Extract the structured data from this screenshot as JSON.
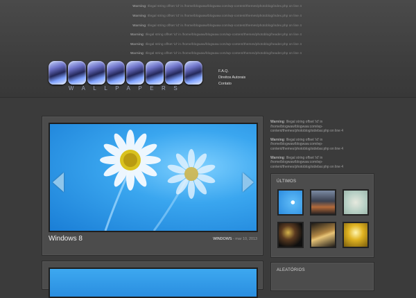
{
  "header": {
    "warnings": [
      {
        "label": "Warning",
        "text": ": Illegal string offset 'id' in /home/blogwaw/blogwaw.com/wp-content/themes/photoblog/index.php on line 4"
      },
      {
        "label": "Warning",
        "text": ": Illegal string offset 'id' in /home/blogwaw/blogwaw.com/wp-content/themes/photoblog/index.php on line 4"
      },
      {
        "label": "Warning",
        "text": ": Illegal string offset 'id' in /home/blogwaw/blogwaw.com/wp-content/themes/photoblog/index.php on line 4"
      },
      {
        "label": "Warning",
        "text": ": Illegal string offset 'id' in /home/blogwaw/blogwaw.com/wp-content/themes/photoblog/header.php on line 4"
      },
      {
        "label": "Warning",
        "text": ": Illegal string offset 'id' in /home/blogwaw/blogwaw.com/wp-content/themes/photoblog/header.php on line 4"
      },
      {
        "label": "Warning",
        "text": ": Illegal string offset 'id' in /home/blogwaw/blogwaw.com/wp-content/themes/photoblog/header.php on line 4"
      }
    ],
    "logo_subtitle": "WALLPAPERS",
    "nav": [
      "F.A.Q.",
      "Direitos Autorais",
      "Contato"
    ]
  },
  "post": {
    "title": "Windows 8",
    "category": "WINDOWS",
    "separator": " - ",
    "date": "mar 10, 2013"
  },
  "sidebar": {
    "warnings": [
      {
        "label": "Warning",
        "text": ": Illegal string offset 'id' in /home/blogwaw/blogwaw.com/wp-content/themes/photoblog/sidebar.php on line 4"
      },
      {
        "label": "Warning",
        "text": ": Illegal string offset 'id' in /home/blogwaw/blogwaw.com/wp-content/themes/photoblog/sidebar.php on line 4"
      },
      {
        "label": "Warning",
        "text": ": Illegal string offset 'id' in /home/blogwaw/blogwaw.com/wp-content/themes/photoblog/sidebar.php on line 4"
      }
    ],
    "ultimos_title": "ÚLTIMOS",
    "aleatorios_title": "ALEATÓRIOS"
  },
  "colors": {
    "background": "#3b3b3b",
    "card": "#4c4c4c",
    "accent_sky": "#3aa6ef"
  }
}
